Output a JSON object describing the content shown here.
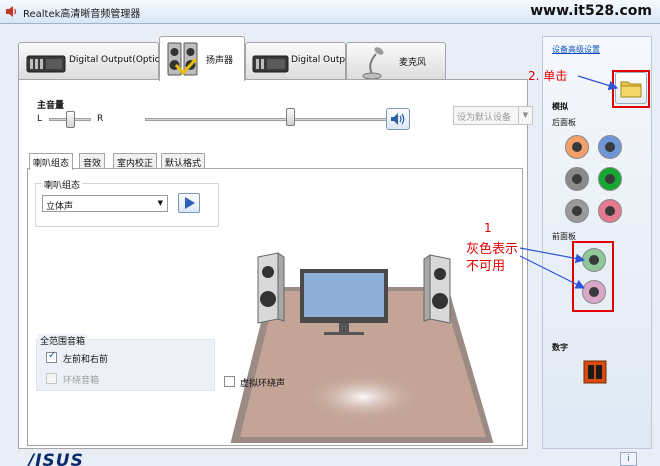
{
  "window": {
    "title": "Realtek高清晰音频管理器",
    "watermark": "www.it528.com"
  },
  "main_tabs": [
    {
      "label": "Digital Output(Optical)",
      "active": false
    },
    {
      "label": "扬声器",
      "active": true
    },
    {
      "label": "Digital Output",
      "active": false
    },
    {
      "label": "麦克风",
      "active": false
    }
  ],
  "volume": {
    "heading": "主音量",
    "left": "L",
    "right": "R",
    "balance_level": 0.5,
    "volume_level": 0.55,
    "default_device": "设为默认设备"
  },
  "sub_tabs": [
    "喇叭组态",
    "音效",
    "室内校正",
    "默认格式"
  ],
  "speaker_config": {
    "group_title": "喇叭组态",
    "selected": "立体声",
    "full_range_title": "全范围音箱",
    "front_lr_label": "左前和右前",
    "front_lr_checked": true,
    "surround_label": "环绕音箱",
    "surround_checked": false,
    "virtual_surround_label": "虚拟环绕声",
    "virtual_surround_checked": false
  },
  "right_panel": {
    "advanced_link": "设备高级设置",
    "analog_heading": "模拟",
    "back_panel": "后面板",
    "front_panel": "前面板",
    "digital_heading": "数字",
    "back_jacks": [
      "#f3a06b",
      "#6f97d8",
      "#8a8a8a",
      "#16a832",
      "#9a9a9a",
      "#e57a8e"
    ],
    "front_jacks": [
      "#8fc79b",
      "#d8a8c6"
    ]
  },
  "annotations": {
    "step2": "2. 单击",
    "step1": "1",
    "gray_line1": "灰色表示",
    "gray_line2": "不可用"
  },
  "brand": "/ISUS",
  "colors": {
    "accent": "#0b4fc0",
    "annotation_red": "#e40000",
    "floor": "#c4a497"
  }
}
